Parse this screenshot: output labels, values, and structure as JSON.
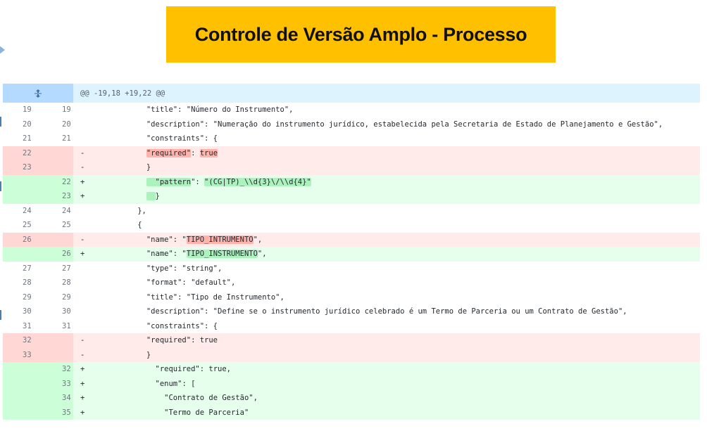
{
  "slide": {
    "title": "Controle de Versão Amplo - Processo"
  },
  "hunk": {
    "header": "@@ -19,18 +19,22 @@"
  },
  "lines": [
    {
      "type": "ctx",
      "old": "19",
      "new": "19",
      "sign": "",
      "indent": "            ",
      "parts": [
        {
          "t": "\"title\": \"Número do Instrumento\","
        }
      ]
    },
    {
      "type": "ctx",
      "old": "20",
      "new": "20",
      "sign": "",
      "indent": "            ",
      "parts": [
        {
          "t": "\"description\": \"Numeração do instrumento jurídico, estabelecida pela Secretaria de Estado de Planejamento e Gestão\","
        }
      ]
    },
    {
      "type": "ctx",
      "old": "21",
      "new": "21",
      "sign": "",
      "indent": "            ",
      "parts": [
        {
          "t": "\"constraints\": {"
        }
      ]
    },
    {
      "type": "del",
      "old": "22",
      "new": "",
      "sign": "-",
      "indent": "            ",
      "parts": [
        {
          "t": "\"required\"",
          "hl": true
        },
        {
          "t": ": "
        },
        {
          "t": "true",
          "hl": true
        }
      ]
    },
    {
      "type": "del",
      "old": "23",
      "new": "",
      "sign": "-",
      "indent": "            ",
      "parts": [
        {
          "t": "}"
        }
      ]
    },
    {
      "type": "add",
      "old": "",
      "new": "22",
      "sign": "+",
      "indent": "            ",
      "parts": [
        {
          "t": "  \"pattern",
          "hl": true
        },
        {
          "t": "\": "
        },
        {
          "t": "\"(CG|TP)_\\\\d{3}\\/\\\\d{4}\"",
          "hl": true
        }
      ]
    },
    {
      "type": "add",
      "old": "",
      "new": "23",
      "sign": "+",
      "indent": "            ",
      "parts": [
        {
          "t": "  ",
          "hl": true
        },
        {
          "t": "}"
        }
      ]
    },
    {
      "type": "ctx",
      "old": "24",
      "new": "24",
      "sign": "",
      "indent": "          ",
      "parts": [
        {
          "t": "},"
        }
      ]
    },
    {
      "type": "ctx",
      "old": "25",
      "new": "25",
      "sign": "",
      "indent": "          ",
      "parts": [
        {
          "t": "{"
        }
      ]
    },
    {
      "type": "del",
      "old": "26",
      "new": "",
      "sign": "-",
      "indent": "            ",
      "parts": [
        {
          "t": "\"name\": \""
        },
        {
          "t": "TIPO_INTRUMENTO",
          "hl": true
        },
        {
          "t": "\","
        }
      ]
    },
    {
      "type": "add",
      "old": "",
      "new": "26",
      "sign": "+",
      "indent": "            ",
      "parts": [
        {
          "t": "\"name\": \""
        },
        {
          "t": "TIPO_INSTRUMENTO",
          "hl": true
        },
        {
          "t": "\","
        }
      ]
    },
    {
      "type": "ctx",
      "old": "27",
      "new": "27",
      "sign": "",
      "indent": "            ",
      "parts": [
        {
          "t": "\"type\": \"string\","
        }
      ]
    },
    {
      "type": "ctx",
      "old": "28",
      "new": "28",
      "sign": "",
      "indent": "            ",
      "parts": [
        {
          "t": "\"format\": \"default\","
        }
      ]
    },
    {
      "type": "ctx",
      "old": "29",
      "new": "29",
      "sign": "",
      "indent": "            ",
      "parts": [
        {
          "t": "\"title\": \"Tipo de Instrumento\","
        }
      ]
    },
    {
      "type": "ctx",
      "old": "30",
      "new": "30",
      "sign": "",
      "indent": "            ",
      "parts": [
        {
          "t": "\"description\": \"Define se o instrumento jurídico celebrado é um Termo de Parceria ou um Contrato de Gestão\","
        }
      ]
    },
    {
      "type": "ctx",
      "old": "31",
      "new": "31",
      "sign": "",
      "indent": "            ",
      "parts": [
        {
          "t": "\"constraints\": {"
        }
      ]
    },
    {
      "type": "del",
      "old": "32",
      "new": "",
      "sign": "-",
      "indent": "            ",
      "parts": [
        {
          "t": "\"required\": true"
        }
      ]
    },
    {
      "type": "del",
      "old": "33",
      "new": "",
      "sign": "-",
      "indent": "            ",
      "parts": [
        {
          "t": "}"
        }
      ]
    },
    {
      "type": "add",
      "old": "",
      "new": "32",
      "sign": "+",
      "indent": "              ",
      "parts": [
        {
          "t": "\"required\": true,"
        }
      ]
    },
    {
      "type": "add",
      "old": "",
      "new": "33",
      "sign": "+",
      "indent": "              ",
      "parts": [
        {
          "t": "\"enum\": ["
        }
      ]
    },
    {
      "type": "add",
      "old": "",
      "new": "34",
      "sign": "+",
      "indent": "                ",
      "parts": [
        {
          "t": "\"Contrato de Gestão\","
        }
      ]
    },
    {
      "type": "add",
      "old": "",
      "new": "35",
      "sign": "+",
      "indent": "                ",
      "parts": [
        {
          "t": "\"Termo de Parceria\""
        }
      ]
    }
  ],
  "icons": {
    "expand": "expand-vertical-icon",
    "pointer": "arrow-right-icon"
  },
  "colors": {
    "banner": "#ffc000",
    "hunk_bg": "#ddf4ff",
    "deleted_bg": "#ffebe9",
    "added_bg": "#e6ffec"
  }
}
